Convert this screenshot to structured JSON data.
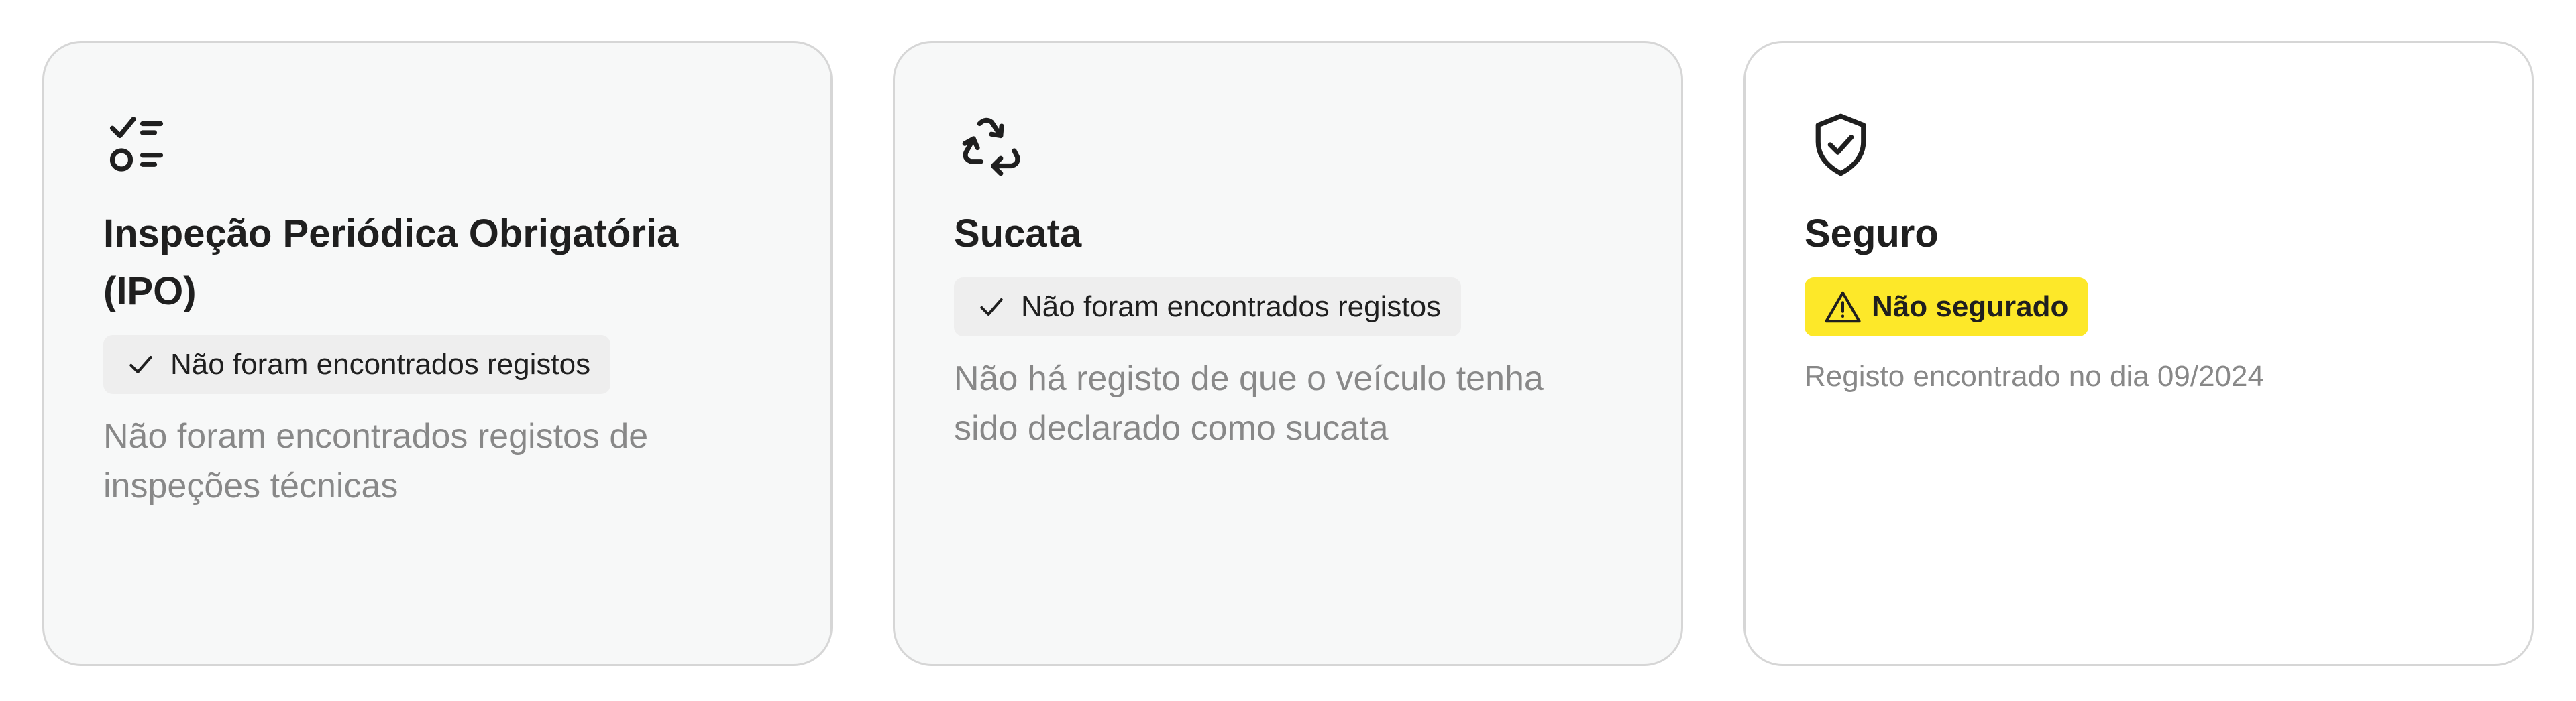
{
  "cards": [
    {
      "icon": "checklist-icon",
      "title": "Inspeção Periódica Obrigatória (IPO)",
      "status_label": "Não foram encontrados registos",
      "status_icon": "check-icon",
      "description": "Não foram encontrados registos de inspeções técnicas"
    },
    {
      "icon": "recycle-icon",
      "title": "Sucata",
      "status_label": "Não foram encontrados registos",
      "status_icon": "check-icon",
      "description": "Não há registo de que o veículo tenha sido declarado como sucata"
    },
    {
      "icon": "shield-check-icon",
      "title": "Seguro",
      "status_label": "Não segurado",
      "status_icon": "warning-icon",
      "description": "Registo encontrado no dia 09/2024"
    }
  ],
  "colors": {
    "card_border": "#d6d6d6",
    "card_bg_gray": "#f7f8f8",
    "chip_bg": "#eeeeee",
    "warning_bg": "#fde829",
    "title_text": "#1f1f1f",
    "muted_text": "#888888"
  }
}
